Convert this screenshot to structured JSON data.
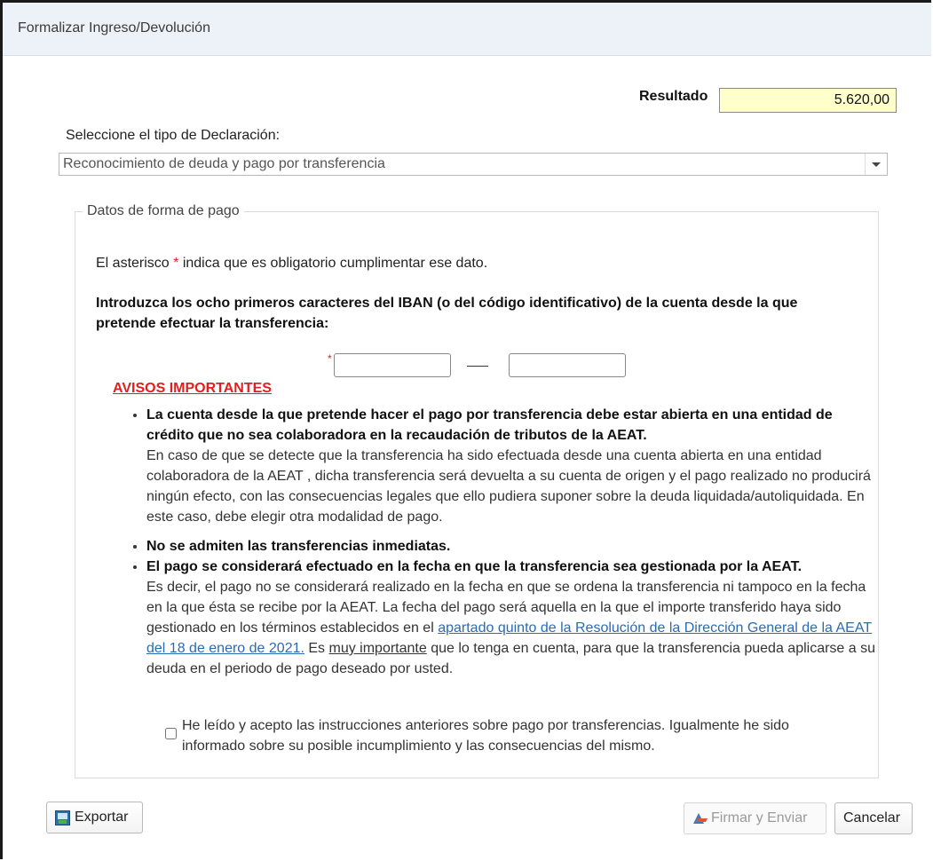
{
  "window": {
    "title": "Formalizar Ingreso/Devolución"
  },
  "resultado": {
    "label": "Resultado",
    "value": "5.620,00"
  },
  "declaracion": {
    "label": "Seleccione el tipo de Declaración:",
    "selected": "Reconocimiento de deuda y pago por transferencia"
  },
  "forma_pago": {
    "legend": "Datos de forma de pago",
    "asterisk_note_before": "El asterisco ",
    "asterisk_symbol": "*",
    "asterisk_note_after": " indica que es obligatorio cumplimentar ese dato.",
    "iban_instruction": "Introduzca los ocho primeros caracteres del IBAN (o del código identificativo) de la cuenta desde la que pretende efectuar la transferencia:",
    "iban_required": "*",
    "iban_part1": "",
    "iban_part2": "",
    "avisos_title": "AVISOS IMPORTANTES",
    "aviso1_bold": "La cuenta desde la que pretende hacer el pago por transferencia debe estar abierta en una entidad de crédito que no sea colaboradora en la recaudación de tributos de la AEAT.",
    "aviso1_text": "En caso de que se detecte que la transferencia ha sido efectuada desde una cuenta abierta en una entidad colaboradora de la AEAT , dicha transferencia será devuelta a su cuenta de origen y el pago realizado no producirá ningún efecto, con las consecuencias legales que ello pudiera suponer sobre la deuda liquidada/autoliquidada. En este caso, debe elegir otra modalidad de pago.",
    "aviso2_bold": "No se admiten las transferencias inmediatas.",
    "aviso3_bold": "El pago se considerará efectuado en la fecha en que la transferencia sea gestionada por la AEAT.",
    "aviso3_text_before": "Es decir, el pago no se considerará realizado en la fecha en que se ordena la transferencia ni tampoco en la fecha en la que ésta se recibe por la AEAT. La fecha del pago será aquella en la que el importe transferido haya sido gestionado en los términos establecidos en el ",
    "aviso3_link": "apartado quinto de la Resolución de la Dirección General de la AEAT del 18 de enero de 2021.",
    "aviso3_text_mid": " Es ",
    "aviso3_underline": "muy importante",
    "aviso3_text_after": " que lo tenga en cuenta, para que la transferencia pueda aplicarse a su deuda en el periodo de pago deseado por usted.",
    "accept_label": "He leído y acepto las instrucciones anteriores sobre pago por transferencias. Igualmente he sido informado sobre su posible incumplimiento y las consecuencias del mismo."
  },
  "buttons": {
    "exportar": "Exportar",
    "firmar": "Firmar y Enviar",
    "cancelar": "Cancelar"
  },
  "icons": {
    "exportar": "export-icon",
    "firmar": "signature-icon",
    "dropdown": "chevron-down-icon"
  }
}
